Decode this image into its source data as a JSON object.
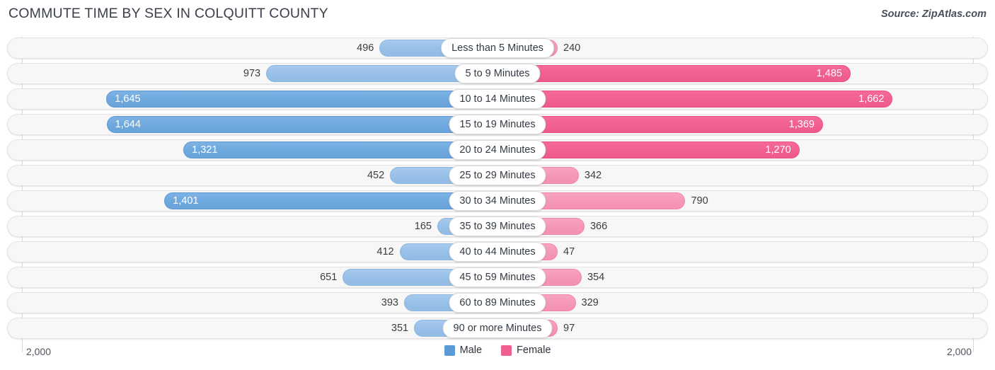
{
  "header": {
    "title": "COMMUTE TIME BY SEX IN COLQUITT COUNTY",
    "source": "Source: ZipAtlas.com"
  },
  "axis": {
    "left_label": "2,000",
    "right_label": "2,000",
    "max": 2000
  },
  "legend": {
    "male_label": "Male",
    "female_label": "Female",
    "male_color": "#5b9bd5",
    "female_color": "#f0608f"
  },
  "chart_data": {
    "type": "bar",
    "title": "COMMUTE TIME BY SEX IN COLQUITT COUNTY",
    "subtitle": "Source: ZipAtlas.com",
    "orientation": "horizontal-diverging",
    "xlabel": "",
    "ylabel": "",
    "xlim": [
      2000,
      2000
    ],
    "grid": true,
    "legend_position": "bottom-center",
    "categories": [
      "Less than 5 Minutes",
      "5 to 9 Minutes",
      "10 to 14 Minutes",
      "15 to 19 Minutes",
      "20 to 24 Minutes",
      "25 to 29 Minutes",
      "30 to 34 Minutes",
      "35 to 39 Minutes",
      "40 to 44 Minutes",
      "45 to 59 Minutes",
      "60 to 89 Minutes",
      "90 or more Minutes"
    ],
    "series": [
      {
        "name": "Male",
        "color": "#5b9bd5",
        "values": [
          496,
          973,
          1645,
          1644,
          1321,
          452,
          1401,
          165,
          412,
          651,
          393,
          351
        ],
        "labels": [
          "496",
          "973",
          "1,645",
          "1,644",
          "1,321",
          "452",
          "1,401",
          "165",
          "412",
          "651",
          "393",
          "351"
        ]
      },
      {
        "name": "Female",
        "color": "#f0608f",
        "values": [
          240,
          1485,
          1662,
          1369,
          1270,
          342,
          790,
          366,
          47,
          354,
          329,
          97
        ],
        "labels": [
          "240",
          "1,485",
          "1,662",
          "1,369",
          "1,270",
          "342",
          "790",
          "366",
          "47",
          "354",
          "329",
          "97"
        ]
      }
    ],
    "rows": [
      {
        "label": "Less than 5 Minutes",
        "male": 496,
        "male_text": "496",
        "male_inside": false,
        "female": 240,
        "female_text": "240",
        "female_inside": false
      },
      {
        "label": "5 to 9 Minutes",
        "male": 973,
        "male_text": "973",
        "male_inside": false,
        "female": 1485,
        "female_text": "1,485",
        "female_inside": true
      },
      {
        "label": "10 to 14 Minutes",
        "male": 1645,
        "male_text": "1,645",
        "male_inside": true,
        "female": 1662,
        "female_text": "1,662",
        "female_inside": true
      },
      {
        "label": "15 to 19 Minutes",
        "male": 1644,
        "male_text": "1,644",
        "male_inside": true,
        "female": 1369,
        "female_text": "1,369",
        "female_inside": true
      },
      {
        "label": "20 to 24 Minutes",
        "male": 1321,
        "male_text": "1,321",
        "male_inside": true,
        "female": 1270,
        "female_text": "1,270",
        "female_inside": true
      },
      {
        "label": "25 to 29 Minutes",
        "male": 452,
        "male_text": "452",
        "male_inside": false,
        "female": 342,
        "female_text": "342",
        "female_inside": false
      },
      {
        "label": "30 to 34 Minutes",
        "male": 1401,
        "male_text": "1,401",
        "male_inside": true,
        "female": 790,
        "female_text": "790",
        "female_inside": false
      },
      {
        "label": "35 to 39 Minutes",
        "male": 165,
        "male_text": "165",
        "male_inside": false,
        "female": 366,
        "female_text": "366",
        "female_inside": false
      },
      {
        "label": "40 to 44 Minutes",
        "male": 412,
        "male_text": "412",
        "male_inside": false,
        "female": 47,
        "female_text": "47",
        "female_inside": false
      },
      {
        "label": "45 to 59 Minutes",
        "male": 651,
        "male_text": "651",
        "male_inside": false,
        "female": 354,
        "female_text": "354",
        "female_inside": false
      },
      {
        "label": "60 to 89 Minutes",
        "male": 393,
        "male_text": "393",
        "male_inside": false,
        "female": 329,
        "female_text": "329",
        "female_inside": false
      },
      {
        "label": "90 or more Minutes",
        "male": 351,
        "male_text": "351",
        "male_inside": false,
        "female": 97,
        "female_text": "97",
        "female_inside": false
      }
    ]
  }
}
